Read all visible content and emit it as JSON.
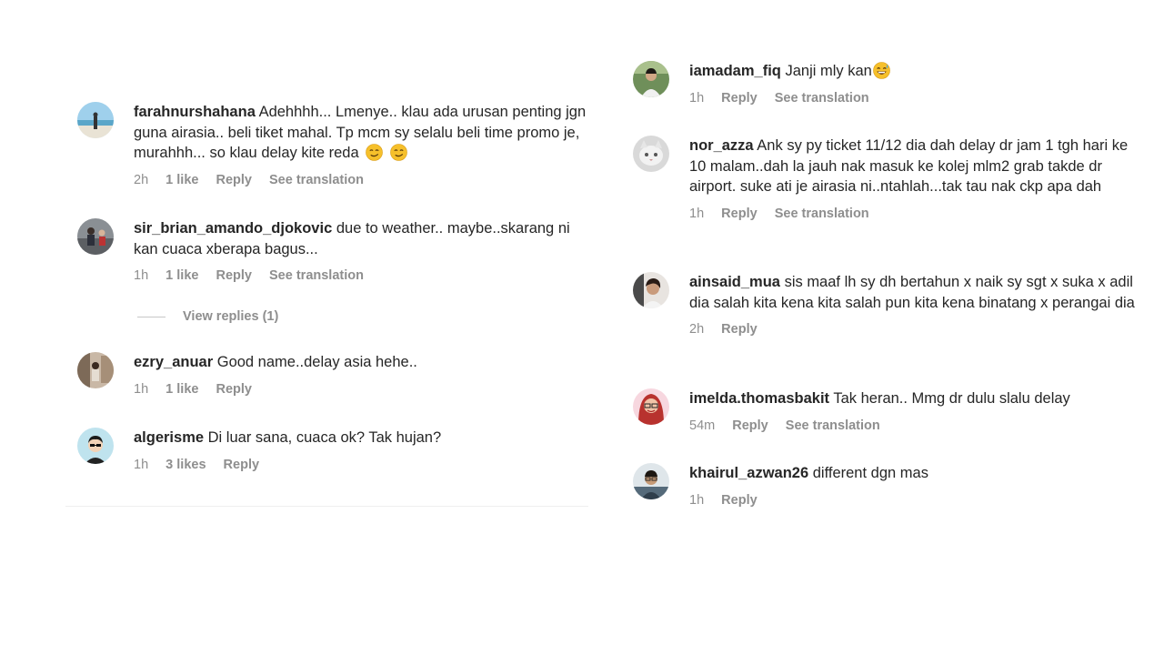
{
  "left_comments": [
    {
      "username": "farahnurshahana",
      "text": "Adehhhh... Lmenye.. klau ada urusan penting jgn guna airasia.. beli tiket mahal. Tp mcm sy selalu beli time promo je, murahhh... so klau delay kite reda",
      "emojis": [
        "smirk-face-icon",
        "smirk-face-icon"
      ],
      "time": "2h",
      "likes": "1 like",
      "reply": "Reply",
      "translation": "See translation"
    },
    {
      "username": "sir_brian_amando_djokovic",
      "text": "due to weather.. maybe..skarang ni kan cuaca xberapa bagus...",
      "time": "1h",
      "likes": "1 like",
      "reply": "Reply",
      "translation": "See translation",
      "view_replies": "View replies (1)"
    },
    {
      "username": "ezry_anuar",
      "text": "Good name..delay asia hehe..",
      "time": "1h",
      "likes": "1 like",
      "reply": "Reply"
    },
    {
      "username": "algerisme",
      "text": "Di luar sana, cuaca ok? Tak hujan?",
      "time": "1h",
      "likes": "3 likes",
      "reply": "Reply"
    }
  ],
  "right_comments": [
    {
      "username": "iamadam_fiq",
      "text": "Janji mly kan",
      "emojis": [
        "grinning-sweat-face-icon"
      ],
      "time": "1h",
      "reply": "Reply",
      "translation": "See translation"
    },
    {
      "username": "nor_azza",
      "text": "Ank sy py ticket 11/12 dia dah delay dr jam 1 tgh hari ke 10 malam..dah la jauh nak masuk ke kolej mlm2 grab takde dr airport. suke ati je airasia ni..ntahlah...tak tau nak ckp apa dah",
      "time": "1h",
      "reply": "Reply",
      "translation": "See translation"
    },
    {
      "username": "ainsaid_mua",
      "text": "sis maaf lh sy dh bertahun x naik sy sgt x suka x adil dia salah kita kena kita salah pun kita kena binatang x perangai dia",
      "time": "2h",
      "reply": "Reply"
    },
    {
      "username": "imelda.thomasbakit",
      "text": "Tak heran.. Mmg dr dulu slalu delay",
      "time": "54m",
      "reply": "Reply",
      "translation": "See translation"
    },
    {
      "username": "khairul_azwan26",
      "text": "different dgn mas",
      "time": "1h",
      "reply": "Reply"
    }
  ],
  "colors": {
    "text": "#262626",
    "meta": "#8e8e8e",
    "divider": "#efefef"
  }
}
